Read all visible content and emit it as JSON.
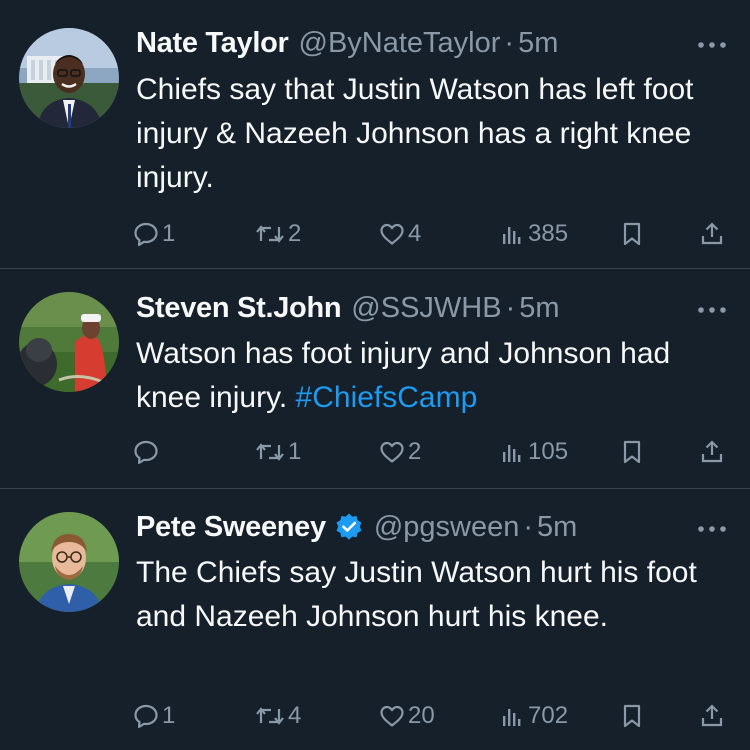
{
  "tweets": [
    {
      "name": "Nate Taylor",
      "handle": "@ByNateTaylor",
      "separator": "·",
      "time": "5m",
      "verified": false,
      "text": "Chiefs say that Justin Watson has left foot injury & Nazeeh Johnson has a right knee injury.",
      "hashtag": "",
      "replies": "1",
      "retweets": "2",
      "likes": "4",
      "views": "385"
    },
    {
      "name": "Steven St.John",
      "handle": "@SSJWHB",
      "separator": "·",
      "time": "5m",
      "verified": false,
      "text": "Watson has foot injury and Johnson had knee injury. ",
      "hashtag": "#ChiefsCamp",
      "replies": "",
      "retweets": "1",
      "likes": "2",
      "views": "105"
    },
    {
      "name": "Pete Sweeney",
      "handle": "@pgsween",
      "separator": "·",
      "time": "5m",
      "verified": true,
      "text": "The Chiefs say Justin Watson hurt his foot and Nazeeh Johnson hurt his knee.",
      "hashtag": "",
      "replies": "1",
      "retweets": "4",
      "likes": "20",
      "views": "702"
    }
  ],
  "colors": {
    "background": "#15202b",
    "text": "#f7f9f9",
    "secondary": "#8b98a5",
    "accent": "#1d9bf0",
    "divider": "#38444d"
  },
  "icons": {
    "reply": "speech-bubble",
    "retweet": "retweet-arrows",
    "like": "heart-outline",
    "views": "bar-chart",
    "bookmark": "bookmark",
    "share": "upload-arrow",
    "more": "three-dots",
    "verified": "blue-check-badge"
  }
}
